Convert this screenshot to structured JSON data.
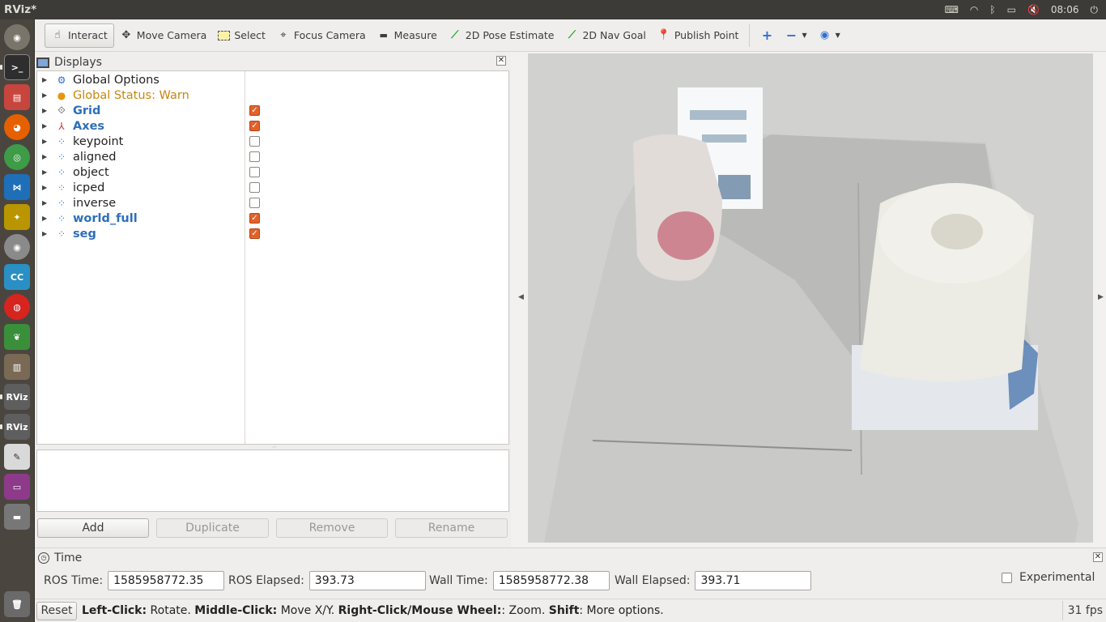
{
  "window": {
    "title": "RViz*"
  },
  "tray": {
    "time": "08:06"
  },
  "toolbar": {
    "interact": "Interact",
    "move_camera": "Move Camera",
    "select": "Select",
    "focus_camera": "Focus Camera",
    "measure": "Measure",
    "pose_estimate": "2D Pose Estimate",
    "nav_goal": "2D Nav Goal",
    "publish_point": "Publish Point"
  },
  "displays": {
    "title": "Displays",
    "items": [
      {
        "label": "Global Options",
        "style": "normal",
        "checked": null,
        "icon": "gear-icon"
      },
      {
        "label": "Global Status: Warn",
        "style": "warn",
        "checked": null,
        "icon": "warning-icon"
      },
      {
        "label": "Grid",
        "style": "bold",
        "checked": true,
        "icon": "grid-icon"
      },
      {
        "label": "Axes",
        "style": "bold",
        "checked": true,
        "icon": "axes-icon"
      },
      {
        "label": "keypoint",
        "style": "normal",
        "checked": false,
        "icon": "pointcloud-icon"
      },
      {
        "label": "aligned",
        "style": "normal",
        "checked": false,
        "icon": "pointcloud-icon"
      },
      {
        "label": "object",
        "style": "normal",
        "checked": false,
        "icon": "pointcloud-icon"
      },
      {
        "label": "icped",
        "style": "normal",
        "checked": false,
        "icon": "pointcloud-icon"
      },
      {
        "label": "inverse",
        "style": "normal",
        "checked": false,
        "icon": "pointcloud-icon"
      },
      {
        "label": "world_full",
        "style": "bold",
        "checked": true,
        "icon": "pointcloud-icon"
      },
      {
        "label": "seg",
        "style": "bold",
        "checked": true,
        "icon": "pointcloud-icon"
      }
    ],
    "buttons": {
      "add": "Add",
      "duplicate": "Duplicate",
      "remove": "Remove",
      "rename": "Rename"
    }
  },
  "time": {
    "title": "Time",
    "ros_time_label": "ROS Time:",
    "ros_time": "1585958772.35",
    "ros_elapsed_label": "ROS Elapsed:",
    "ros_elapsed": "393.73",
    "wall_time_label": "Wall Time:",
    "wall_time": "1585958772.38",
    "wall_elapsed_label": "Wall Elapsed:",
    "wall_elapsed": "393.71",
    "experimental": "Experimental"
  },
  "status": {
    "reset": "Reset",
    "help": [
      {
        "key": "Left-Click:",
        "text": " Rotate. "
      },
      {
        "key": "Middle-Click:",
        "text": " Move X/Y. "
      },
      {
        "key": "Right-Click/Mouse Wheel:",
        "text": ": Zoom. "
      },
      {
        "key": "Shift",
        "text": ": More options."
      }
    ],
    "fps": "31 fps"
  },
  "colors": {
    "accent": "#2d6fba",
    "warn": "#c7860c",
    "check": "#e2622b"
  }
}
